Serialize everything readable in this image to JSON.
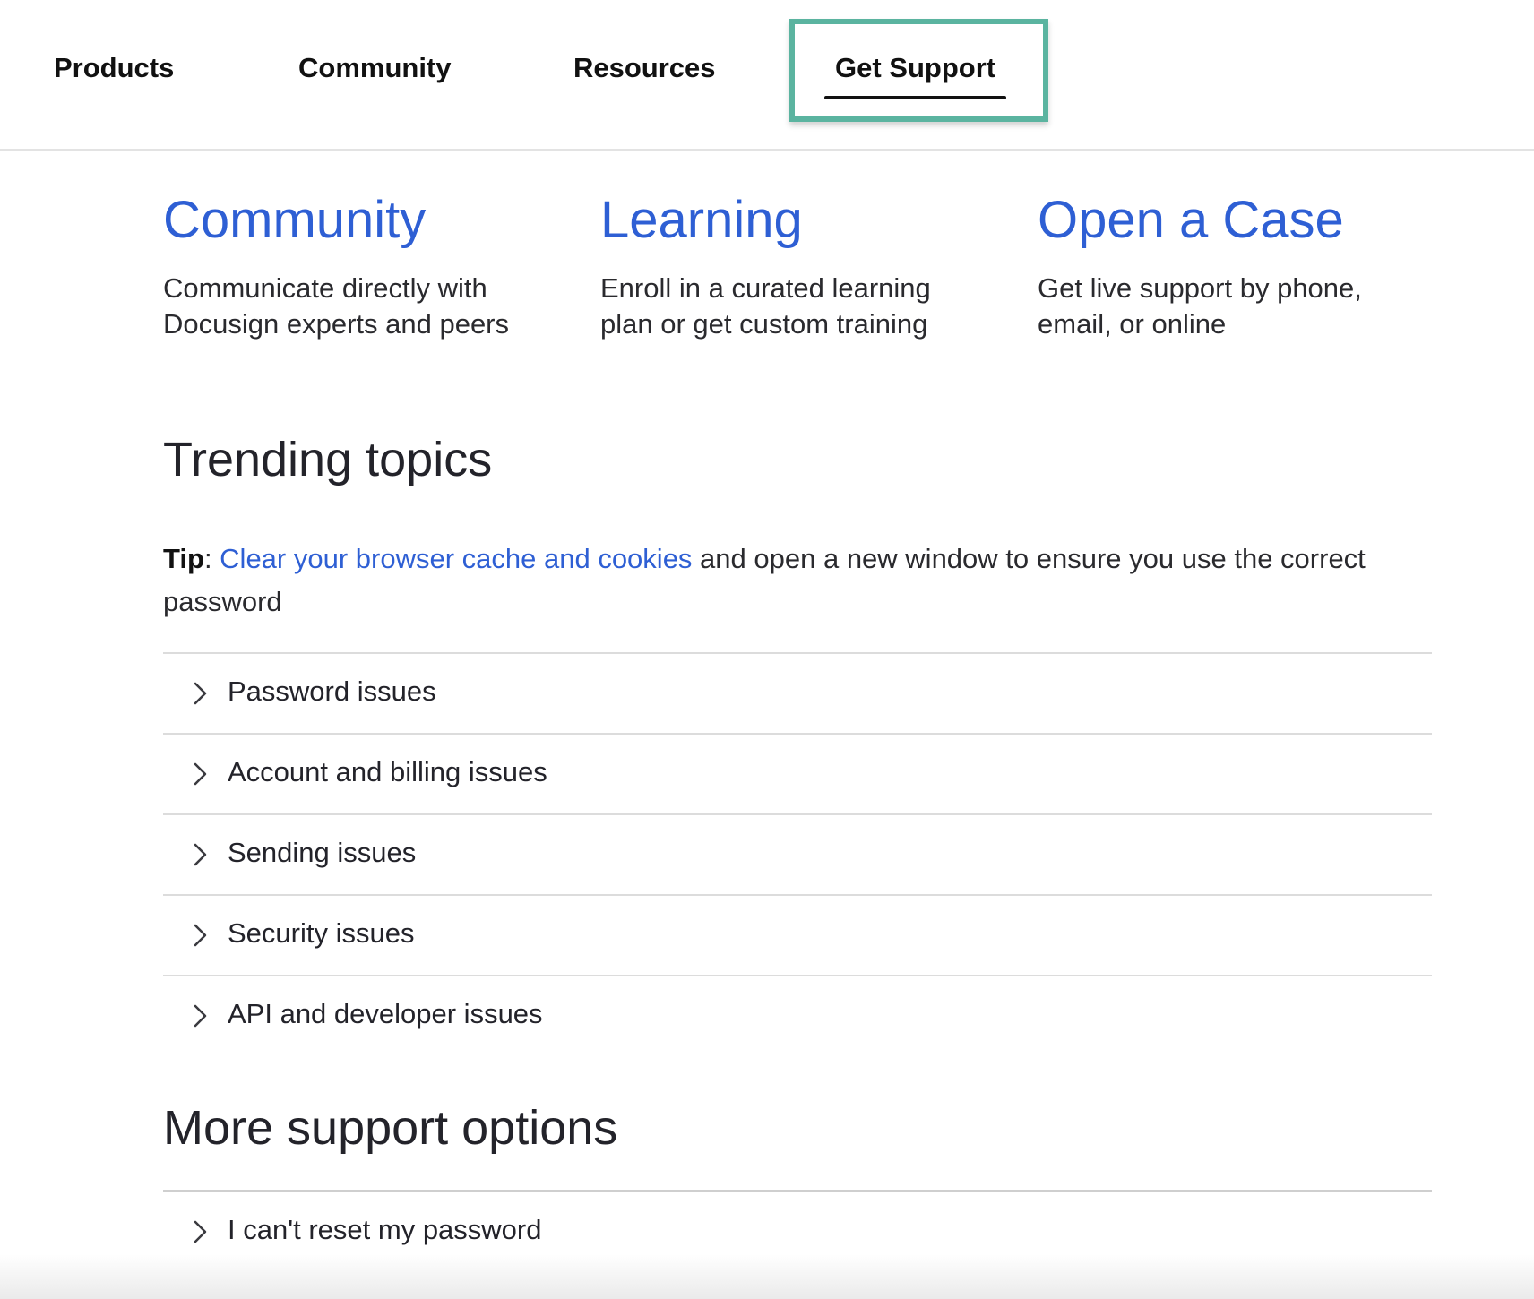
{
  "nav": {
    "products": "Products",
    "community": "Community",
    "resources": "Resources",
    "get_support": "Get Support"
  },
  "cards": [
    {
      "title": "Community",
      "desc_line1": "Communicate directly with",
      "desc_line2": "Docusign experts and peers"
    },
    {
      "title": "Learning",
      "desc_line1": "Enroll in a curated learning",
      "desc_line2": "plan or get custom training"
    },
    {
      "title": "Open a Case",
      "desc_line1": "Get live support by phone,",
      "desc_line2": "email, or online"
    }
  ],
  "trending": {
    "heading": "Trending topics",
    "tip_label": "Tip",
    "tip_link": "Clear your browser cache and cookies",
    "tip_rest": " and open a new window to ensure you use the correct password",
    "items": [
      "Password issues",
      "Account and billing issues",
      "Sending issues",
      "Security issues",
      "API and developer issues"
    ]
  },
  "more": {
    "heading": "More support options",
    "items": [
      "I can't reset my password"
    ]
  },
  "colors": {
    "link_blue": "#2e5fd4",
    "highlight_teal": "#5bb4a0"
  }
}
